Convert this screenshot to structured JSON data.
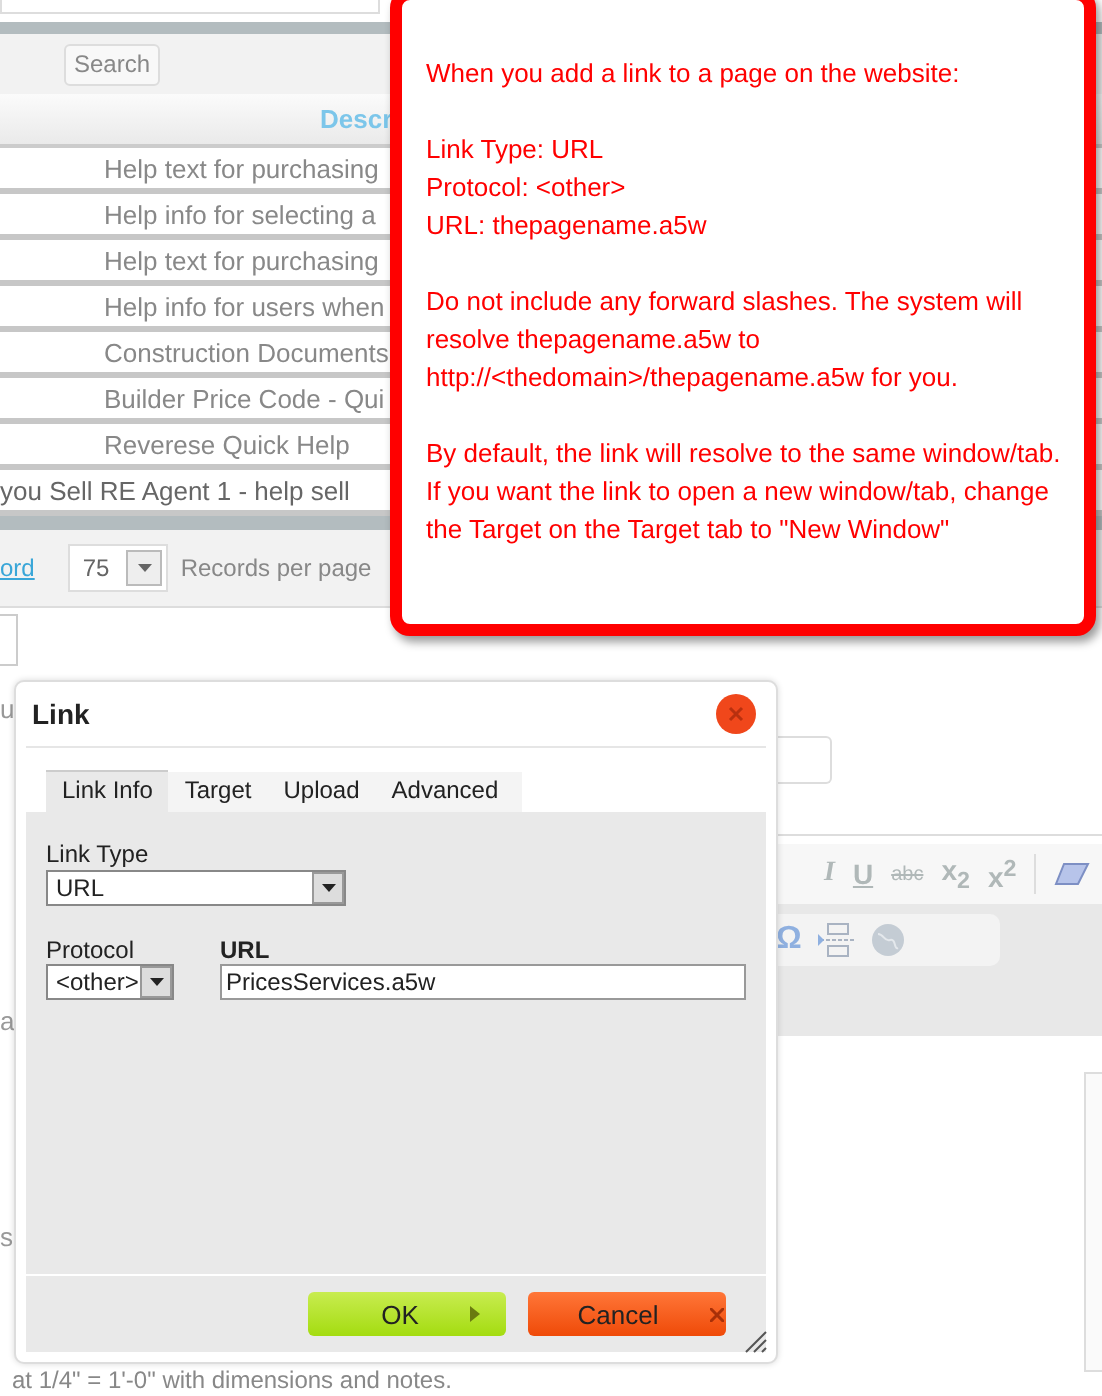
{
  "list_page": {
    "search_button": "Search",
    "column_header": "Descr",
    "rows": [
      {
        "kind": "description",
        "text": "Help text for purchasing"
      },
      {
        "kind": "description",
        "text": "Help info for selecting a"
      },
      {
        "kind": "description",
        "text": "Help text for purchasing"
      },
      {
        "kind": "description",
        "text": "Help info for users when"
      },
      {
        "kind": "description",
        "text": "Construction Documents"
      },
      {
        "kind": "description",
        "text": "Builder Price Code - Qui"
      },
      {
        "kind": "description",
        "text": "Reverese Quick Help"
      },
      {
        "kind": "title",
        "text": "you Sell RE Agent 1 - help sell"
      }
    ],
    "pager": {
      "link": "ord",
      "per_page": "75",
      "per_page_label": "Records per page"
    }
  },
  "editor": {
    "fragments": [
      "u",
      "a",
      "s"
    ],
    "toolbar": [
      {
        "kind": "italic",
        "label": "I"
      },
      {
        "kind": "underline",
        "label": "U"
      },
      {
        "kind": "strike",
        "label": "abc"
      },
      {
        "kind": "text",
        "label": "x$_{2}$"
      },
      {
        "kind": "text",
        "label": "x$^{2}$"
      },
      {
        "kind": "eraser"
      }
    ],
    "toolbar_2": [
      {
        "kind": "text",
        "label": "Ω"
      },
      {
        "kind": "pagebreak"
      },
      {
        "kind": "globe"
      }
    ],
    "body_text": "at 1/4\" = 1'-0\" with dimensions and notes."
  },
  "dialog": {
    "title": "Link",
    "tabs": [
      {
        "label": "Link Info",
        "selected": true
      },
      {
        "label": "Target",
        "selected": false
      },
      {
        "label": "Upload",
        "selected": false
      },
      {
        "label": "Advanced",
        "selected": false
      }
    ],
    "link_type": {
      "label": "Link Type",
      "value": "URL"
    },
    "protocol": {
      "label": "Protocol",
      "value": "<other>"
    },
    "url": {
      "label": "URL",
      "value": "PricesServices.a5w"
    },
    "buttons": [
      {
        "kind": "ok",
        "label": "OK"
      },
      {
        "kind": "cancel",
        "label": "Cancel"
      }
    ]
  },
  "callout": {
    "paragraphs": [
      [
        "When you add a link to a page on the website:"
      ],
      [
        "Link Type: URL",
        "Protocol: <other>",
        "URL: thepagename.a5w"
      ],
      [
        "Do not include any forward slashes. The system will resolve thepagename.a5w to http://<thedomain>/thepagename.a5w for you."
      ],
      [
        "By default, the link will resolve to the same window/tab. If you want the link to open a new window/tab, change the Target on the Target tab to \"New Window\""
      ]
    ]
  }
}
